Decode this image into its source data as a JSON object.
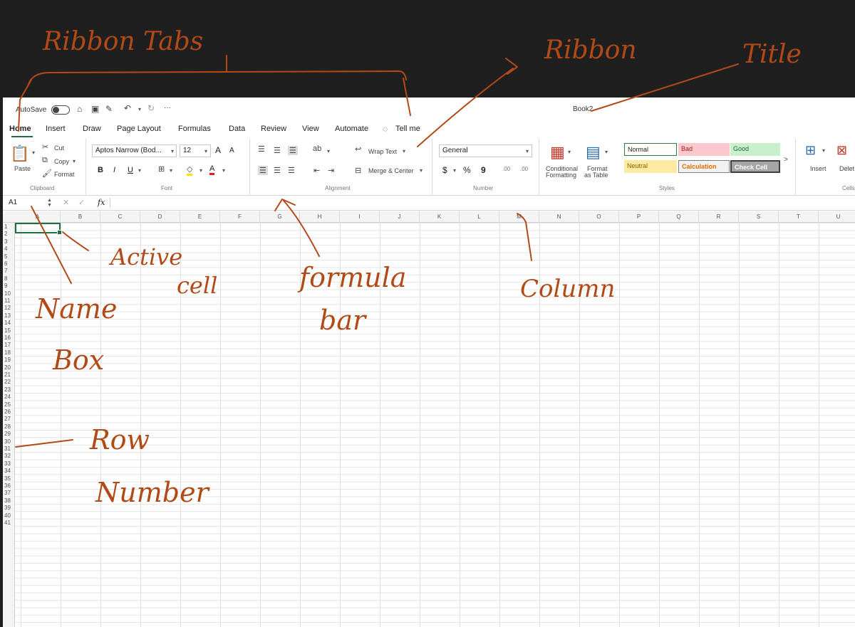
{
  "annotations": {
    "ribbon_tabs": "Ribbon Tabs",
    "ribbon": "Ribbon",
    "title": "Title",
    "active_cell_1": "Active",
    "active_cell_2": "cell",
    "formula_bar_1": "formula",
    "formula_bar_2": "bar",
    "column": "Column",
    "name_box_1": "Name",
    "name_box_2": "Box",
    "row_number_1": "Row",
    "row_number_2": "Number"
  },
  "titlebar": {
    "autosave_label": "AutoSave",
    "more": "···",
    "title": "Book2"
  },
  "tabs": [
    "Home",
    "Insert",
    "Draw",
    "Page Layout",
    "Formulas",
    "Data",
    "Review",
    "View",
    "Automate"
  ],
  "tell_me": "Tell me",
  "ribbon": {
    "clipboard": {
      "paste": "Paste",
      "cut": "Cut",
      "copy": "Copy",
      "format": "Format",
      "group": "Clipboard"
    },
    "font": {
      "name": "Aptos Narrow (Bod...",
      "size": "12",
      "grow": "A",
      "shrink": "A",
      "bold": "B",
      "italic": "I",
      "underline": "U",
      "font_color_letter": "A",
      "group": "Font"
    },
    "alignment": {
      "wrap": "Wrap Text",
      "merge": "Merge & Center",
      "group": "Alignment"
    },
    "number": {
      "format": "General",
      "currency": "$",
      "percent": "%",
      "comma": "9",
      "inc_dec_1": ".00",
      "inc_dec_2": ".00",
      "group": "Number"
    },
    "styles": {
      "conditional": "Conditional",
      "formatting": "Formatting",
      "format": "Format",
      "as_table": "as Table",
      "normal": "Normal",
      "bad": "Bad",
      "good": "Good",
      "neutral": "Neutral",
      "calculation": "Calculation",
      "check_cell": "Check Cell",
      "group": "Styles"
    },
    "cells": {
      "insert": "Insert",
      "delete": "Delet",
      "group": "Cells"
    }
  },
  "formula_bar": {
    "name_box": "A1",
    "cancel": "✕",
    "enter": "✓",
    "fx": "fx"
  },
  "columns": [
    "A",
    "B",
    "C",
    "D",
    "E",
    "F",
    "G",
    "H",
    "I",
    "J",
    "K",
    "L",
    "M",
    "N",
    "O",
    "P",
    "Q",
    "R",
    "S",
    "T",
    "U"
  ],
  "rows": [
    "1",
    "2",
    "3",
    "4",
    "5",
    "6",
    "7",
    "8",
    "9",
    "10",
    "11",
    "12",
    "13",
    "14",
    "15",
    "16",
    "17",
    "18",
    "19",
    "20",
    "21",
    "22",
    "23",
    "24",
    "25",
    "26",
    "27",
    "28",
    "29",
    "30",
    "31",
    "32",
    "33",
    "34",
    "35",
    "36",
    "37",
    "38",
    "39",
    "40",
    "41"
  ],
  "colors": {
    "accent": "#1f6f3f",
    "annotation": "#b24a18"
  }
}
